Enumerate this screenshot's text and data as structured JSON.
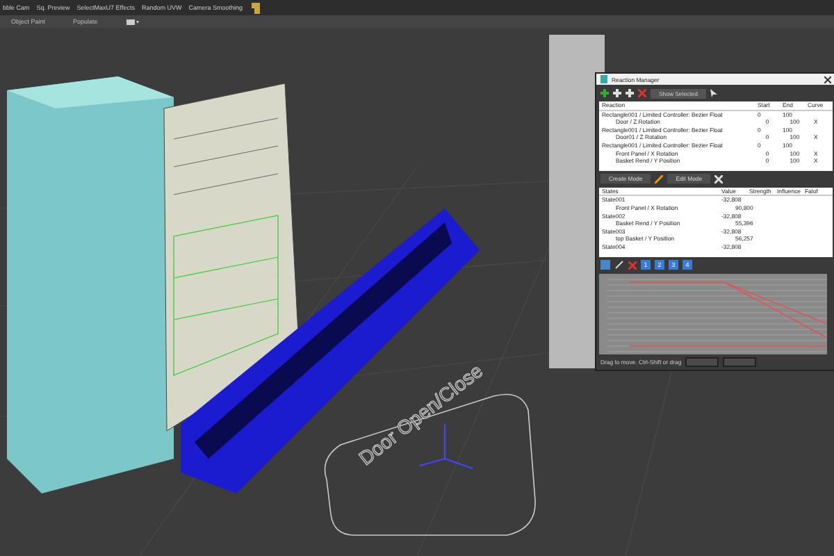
{
  "toolbar": {
    "items": [
      "bble Cam",
      "Sq. Preview",
      "SelectMaxU7 Effects",
      "Random UVW",
      "Camera Smoothing"
    ]
  },
  "ribbon": {
    "tabs": [
      {
        "label": "Object Paint",
        "selected": false
      },
      {
        "label": "Populate",
        "selected": false
      }
    ]
  },
  "viewport": {
    "scene_text": "Door Open/Close"
  },
  "reaction_manager": {
    "title": "Reaction Manager",
    "show_selected": "Show Selected",
    "reaction_columns": [
      "Reaction",
      "Start",
      "End",
      "Curve"
    ],
    "reactions": [
      {
        "name": "Rectangle001 / Limited Controller: Bezier Float",
        "start": "0",
        "end": "100",
        "children": [
          {
            "name": "Door / Z Rotation",
            "start": "0",
            "end": "100",
            "curve": "X"
          }
        ]
      },
      {
        "name": "Rectangle001 / Limited Controller: Bezier Float",
        "start": "0",
        "end": "100",
        "children": [
          {
            "name": "Door01 / Z Rotation",
            "start": "0",
            "end": "100",
            "curve": "X"
          }
        ]
      },
      {
        "name": "Rectangle001 / Limited Controller: Bezier Float",
        "start": "0",
        "end": "100",
        "children": [
          {
            "name": "Front Panel / X Rotation",
            "start": "0",
            "end": "100",
            "curve": "X"
          },
          {
            "name": "Basket Rend / Y Position",
            "start": "0",
            "end": "100",
            "curve": "X"
          }
        ]
      }
    ],
    "create_mode": "Create Mode",
    "edit_mode": "Edit Mode",
    "state_columns": [
      "States",
      "Value",
      "Strength",
      "Influence",
      "Falof"
    ],
    "states": [
      {
        "name": "State001",
        "value": "-32,808",
        "children": [
          {
            "name": "Front Panel / X Rotation",
            "value": "90,800"
          }
        ]
      },
      {
        "name": "State002",
        "value": "-32,808",
        "children": [
          {
            "name": "Basket Rend / Y Position",
            "value": "55,396"
          }
        ]
      },
      {
        "name": "State003",
        "value": "-32,808",
        "children": [
          {
            "name": "top Basket / Y Position",
            "value": "56,257"
          }
        ]
      },
      {
        "name": "State004",
        "value": "-32,808"
      }
    ],
    "layers": [
      {
        "label": "1",
        "selected": true
      },
      {
        "label": "2",
        "selected": true
      },
      {
        "label": "3",
        "selected": true
      },
      {
        "label": "4",
        "selected": true
      }
    ],
    "status": "Drag to move. Ctrl-Shift or drag"
  }
}
